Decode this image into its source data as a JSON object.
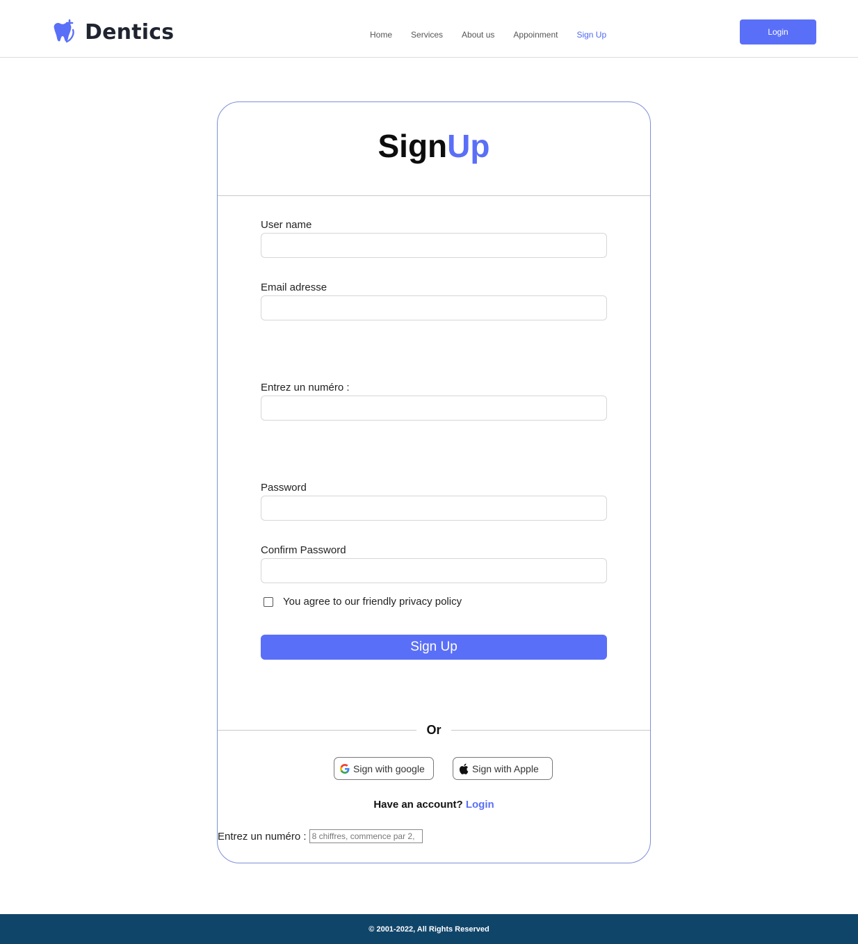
{
  "header": {
    "brand": "Dentics",
    "nav": [
      {
        "label": "Home"
      },
      {
        "label": "Services"
      },
      {
        "label": "About us"
      },
      {
        "label": "Appoinment"
      },
      {
        "label": "Sign Up"
      }
    ],
    "login_label": "Login"
  },
  "card": {
    "title_part1": "Sign",
    "title_part2": "Up",
    "fields": {
      "username": {
        "label": "User name",
        "value": ""
      },
      "email": {
        "label": "Email adresse",
        "value": ""
      },
      "phone": {
        "label": "Entrez un numéro :",
        "value": ""
      },
      "password": {
        "label": "Password",
        "value": ""
      },
      "confirm": {
        "label": "Confirm Password",
        "value": ""
      }
    },
    "agree_label": "You agree to our friendly privacy policy",
    "signup_label": "Sign Up",
    "or_label": "Or",
    "google_label": "Sign with google",
    "apple_label": "Sign with Apple",
    "have_account": "Have an account?",
    "login_link": "Login",
    "phone_inline_label": "Entrez un numéro :",
    "phone_inline_placeholder": "8 chiffres, commence par 2,"
  },
  "footer": {
    "copyright": "© 2001-2022, All Rights Reserved"
  },
  "colors": {
    "accent": "#5a6ff7",
    "footer_bg": "#10456a",
    "card_border": "#7e8fd6"
  },
  "icons": [
    "tooth-icon",
    "google-icon",
    "apple-icon"
  ]
}
